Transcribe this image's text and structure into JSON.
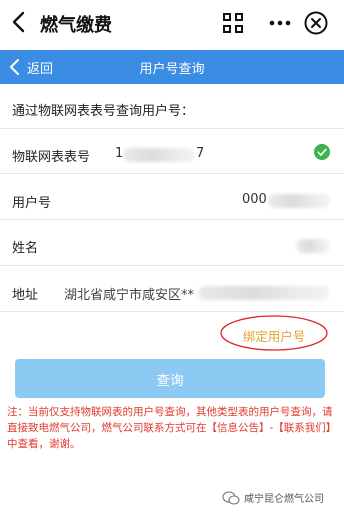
{
  "header": {
    "title": "燃气缴费",
    "icons": [
      "back-arrow-icon",
      "scan-icon",
      "more-icon",
      "close-icon"
    ]
  },
  "nav": {
    "back_label": "返回",
    "title": "用户号查询"
  },
  "form": {
    "prompt": "通过物联网表表号查询用户号：",
    "fields": [
      {
        "label": "物联网表表号",
        "value_start": "1",
        "value_end": "7"
      },
      {
        "label": "用户号",
        "value_start": "000"
      },
      {
        "label": "姓名"
      },
      {
        "label": "地址",
        "value_start": "湖北省咸宁市咸安区**"
      }
    ],
    "bind_link": "绑定用户号",
    "query_button": "查询",
    "note": "注：当前仅支持物联网表的用户号查询，其他类型表的用户号查询，请直接致电燃气公司，燃气公司联系方式可在【信息公告】-【联系我们】中查看，谢谢。"
  },
  "watermark": "咸宁昆仑燃气公司",
  "colors": {
    "nav_bg": "#3a8de2",
    "button_bg": "#8ccaf4",
    "note_text": "#e03a2f",
    "link_text": "#e4a32d",
    "link_circle": "#e0242b",
    "check": "#3fb34f"
  }
}
